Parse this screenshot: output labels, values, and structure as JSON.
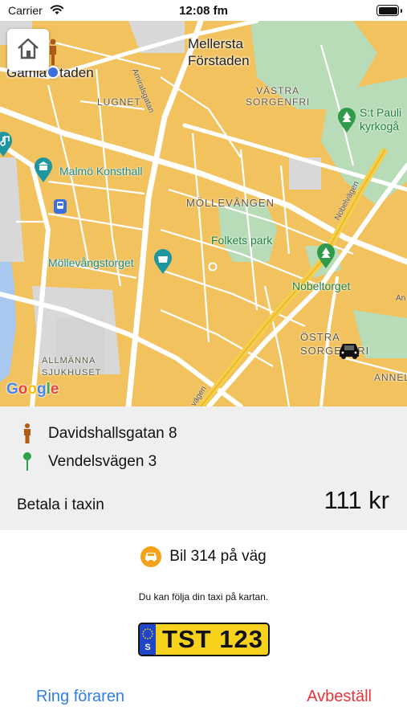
{
  "status_bar": {
    "carrier": "Carrier",
    "time": "12:08 fm"
  },
  "map": {
    "labels": {
      "mellersta_forstaden": "Mellersta\nFörstaden",
      "gamla_staden": "Gamla Staden",
      "lugnet": "LUGNET",
      "vastra_sorgenfri": "VÄSTRA\nSORGENFRI",
      "st_pauli": "S:t Pauli\nkyrkogå",
      "malmo_konsthall": "Malmö Konsthall",
      "mollevangen": "MÖLLEVÅNGEN",
      "folkets_park": "Folkets park",
      "mollevangstorget": "Möllevångstorget",
      "nobeltorget": "Nobeltorget",
      "ostra_sorgenfri": "ÖSTRA\nSORGENFRI",
      "allmanna_sjukhuset": "ALLMÄNNA\nSJUKHUSET",
      "annel": "ANNEL",
      "amiralsgatan": "Amiralsgatan",
      "nobelvagen": "Nobelvägen",
      "vagen": "vägen",
      "an": "An"
    },
    "google_logo": "Google",
    "home_button_icon": "home-icon"
  },
  "trip": {
    "pickup": "Davidshallsgatan 8",
    "destination": "Vendelsvägen 3",
    "payment_label": "Betala i taxin",
    "price": "111 kr"
  },
  "taxi": {
    "status": "Bil 314 på väg",
    "follow_hint": "Du kan följa din taxi på kartan.",
    "plate_country": "S",
    "plate_number": "TST 123"
  },
  "actions": {
    "call_driver": "Ring föraren",
    "cancel": "Avbeställ"
  },
  "colors": {
    "map_base": "#f2c25e",
    "park": "#b8dcb8",
    "accent_blue": "#2f7ee8",
    "cancel_red": "#e8333a",
    "taxi_orange": "#f5a21a",
    "plate_yellow": "#f7d21c"
  }
}
